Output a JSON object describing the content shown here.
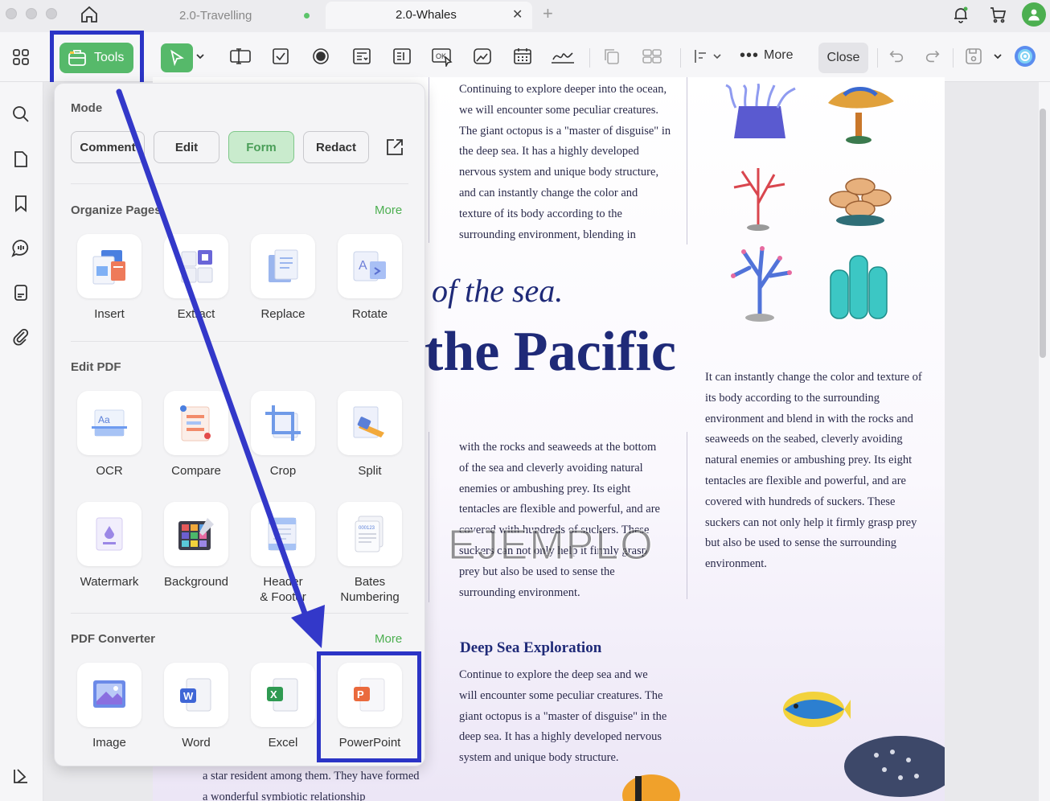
{
  "tabs": [
    {
      "label": "2.0-Travelling"
    },
    {
      "label": "2.0-Whales"
    }
  ],
  "toolbar": {
    "tools_label": "Tools",
    "more_label": "More",
    "close_label": "Close"
  },
  "panel": {
    "mode_title": "Mode",
    "modes": [
      {
        "label": "Comment"
      },
      {
        "label": "Edit"
      },
      {
        "label": "Form"
      },
      {
        "label": "Redact"
      }
    ],
    "organize_title": "Organize Pages",
    "organize_more": "More",
    "organize_tools": [
      {
        "label": "Insert"
      },
      {
        "label": "Extract"
      },
      {
        "label": "Replace"
      },
      {
        "label": "Rotate"
      }
    ],
    "edit_title": "Edit PDF",
    "edit_tools": [
      {
        "label": "OCR"
      },
      {
        "label": "Compare"
      },
      {
        "label": "Crop"
      },
      {
        "label": "Split"
      },
      {
        "label": "Watermark"
      },
      {
        "label": "Background"
      },
      {
        "label": "Header\n& Footer"
      },
      {
        "label": "Bates\nNumbering"
      }
    ],
    "converter_title": "PDF Converter",
    "converter_more": "More",
    "converter_tools": [
      {
        "label": "Image"
      },
      {
        "label": "Word"
      },
      {
        "label": "Excel"
      },
      {
        "label": "PowerPoint"
      }
    ]
  },
  "document": {
    "col1_top": "Continuing to explore deeper into the ocean, we will encounter some peculiar creatures. The giant octopus is a \"master of disguise\" in the deep sea. It has a highly developed nervous system and unique body structure, and can instantly change the color and texture of its body according to the surrounding environment, blending in",
    "heading_italic": "of the sea.",
    "heading_big": "the Pacific",
    "col2_right": "It can instantly change the color and texture of its body according to the surrounding environment and blend in with the rocks and seaweeds on the seabed, cleverly avoiding natural enemies or ambushing prey. Its eight tentacles are flexible and powerful, and are covered with hundreds of suckers. These suckers can not only help it firmly grasp prey but also be used to sense the surrounding environment.",
    "col1_mid": "with the rocks and seaweeds at the bottom of the sea and cleverly avoiding natural enemies or ambushing prey. Its eight tentacles are flexible and powerful, and are covered with hundreds of suckers. These suckers can not only help it firmly grasp prey but also be used to sense the surrounding environment.",
    "watermark": "EJEMPLO",
    "deep_title": "Deep Sea Exploration",
    "deep_text": "Continue to explore the deep sea and we will encounter some peculiar creatures. The giant octopus is a \"master of disguise\" in the deep sea. It has a highly developed nervous system and unique body structure.",
    "bottom_left": "a star resident among them. They have formed a wonderful symbiotic relationship"
  },
  "colors": {
    "accent": "#56b96a",
    "highlight": "#2b34c6",
    "heading": "#1f2a78"
  }
}
